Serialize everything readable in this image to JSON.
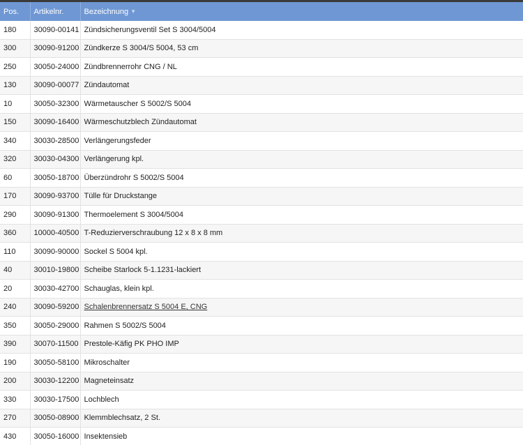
{
  "table": {
    "headers": {
      "pos": "Pos.",
      "artikelnr": "Artikelnr.",
      "bezeichnung": "Bezeichnung"
    },
    "sort_icon": "chevron-down-icon",
    "rows": [
      {
        "pos": "180",
        "artikelnr": "30090-00141",
        "bezeichnung": "Zündsicherungsventil Set S 3004/5004",
        "link": false
      },
      {
        "pos": "300",
        "artikelnr": "30090-91200",
        "bezeichnung": "Zündkerze S 3004/S 5004, 53 cm",
        "link": false
      },
      {
        "pos": "250",
        "artikelnr": "30050-24000",
        "bezeichnung": "Zündbrennerrohr CNG / NL",
        "link": false
      },
      {
        "pos": "130",
        "artikelnr": "30090-00077",
        "bezeichnung": "Zündautomat",
        "link": false
      },
      {
        "pos": "10",
        "artikelnr": "30050-32300",
        "bezeichnung": "Wärmetauscher S 5002/S 5004",
        "link": false
      },
      {
        "pos": "150",
        "artikelnr": "30090-16400",
        "bezeichnung": "Wärmeschutzblech Zündautomat",
        "link": false
      },
      {
        "pos": "340",
        "artikelnr": "30030-28500",
        "bezeichnung": "Verlängerungsfeder",
        "link": false
      },
      {
        "pos": "320",
        "artikelnr": "30030-04300",
        "bezeichnung": "Verlängerung kpl.",
        "link": false
      },
      {
        "pos": "60",
        "artikelnr": "30050-18700",
        "bezeichnung": "Überzündrohr S 5002/S 5004",
        "link": false
      },
      {
        "pos": "170",
        "artikelnr": "30090-93700",
        "bezeichnung": "Tülle für Druckstange",
        "link": false
      },
      {
        "pos": "290",
        "artikelnr": "30090-91300",
        "bezeichnung": "Thermoelement S 3004/5004",
        "link": false
      },
      {
        "pos": "360",
        "artikelnr": "10000-40500",
        "bezeichnung": "T-Reduzierverschraubung 12 x 8 x 8 mm",
        "link": false
      },
      {
        "pos": "110",
        "artikelnr": "30090-90000",
        "bezeichnung": "Sockel S 5004 kpl.",
        "link": false
      },
      {
        "pos": "40",
        "artikelnr": "30010-19800",
        "bezeichnung": "Scheibe Starlock 5-1.1231-lackiert",
        "link": false
      },
      {
        "pos": "20",
        "artikelnr": "30030-42700",
        "bezeichnung": "Schauglas, klein kpl.",
        "link": false
      },
      {
        "pos": "240",
        "artikelnr": "30090-59200",
        "bezeichnung": "Schalenbrennersatz S 5004 E, CNG",
        "link": true
      },
      {
        "pos": "350",
        "artikelnr": "30050-29000",
        "bezeichnung": "Rahmen S 5002/S 5004",
        "link": false
      },
      {
        "pos": "390",
        "artikelnr": "30070-11500",
        "bezeichnung": "Prestole-Käfig PK PHO IMP",
        "link": false
      },
      {
        "pos": "190",
        "artikelnr": "30050-58100",
        "bezeichnung": "Mikroschalter",
        "link": false
      },
      {
        "pos": "200",
        "artikelnr": "30030-12200",
        "bezeichnung": "Magneteinsatz",
        "link": false
      },
      {
        "pos": "330",
        "artikelnr": "30030-17500",
        "bezeichnung": "Lochblech",
        "link": false
      },
      {
        "pos": "270",
        "artikelnr": "30050-08900",
        "bezeichnung": "Klemmblechsatz, 2 St.",
        "link": false
      },
      {
        "pos": "430",
        "artikelnr": "30050-16000",
        "bezeichnung": "Insektensieb",
        "link": false
      }
    ]
  }
}
